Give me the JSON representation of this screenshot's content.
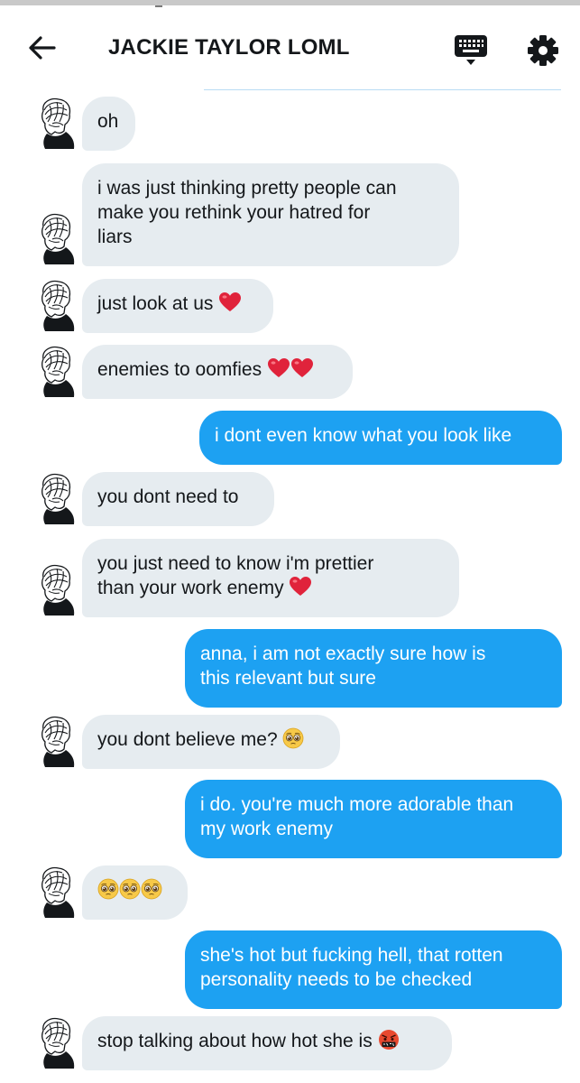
{
  "header": {
    "title": "JACKIE TAYLOR LOML"
  },
  "colors": {
    "incoming_bubble": "#e6ecf0",
    "outgoing_bubble": "#1da1f2",
    "heart": "#e0233b",
    "face": "#f7c948"
  },
  "icons": {
    "back": "arrow-left-icon",
    "keyboard": "keyboard-icon",
    "settings": "gear-icon",
    "avatar": "avatar-portrait"
  },
  "messages": [
    {
      "from": "them",
      "text": "oh"
    },
    {
      "from": "them",
      "text": "i was just thinking pretty people can\nmake you rethink your hatred for\nliars"
    },
    {
      "from": "them",
      "text": "just look at us",
      "emoji": [
        "red-heart"
      ]
    },
    {
      "from": "them",
      "text": "enemies to oomfies",
      "emoji": [
        "red-heart",
        "red-heart"
      ]
    },
    {
      "from": "me",
      "text": "i dont even know what you look like"
    },
    {
      "from": "them",
      "text": "you dont need to"
    },
    {
      "from": "them",
      "text": "you just need to know i'm prettier\nthan your work enemy",
      "emoji": [
        "red-heart"
      ]
    },
    {
      "from": "me",
      "text": "anna, i am not exactly sure how is\nthis relevant but sure"
    },
    {
      "from": "them",
      "text": "you dont believe me?",
      "emoji": [
        "pleading-face"
      ]
    },
    {
      "from": "me",
      "text": "i do. you're much more adorable than\nmy work enemy"
    },
    {
      "from": "them",
      "text": "",
      "emoji": [
        "pleading-face",
        "pleading-face",
        "pleading-face"
      ]
    },
    {
      "from": "me",
      "text": "she's hot but fucking hell, that rotten\npersonality needs to be checked"
    },
    {
      "from": "them",
      "text": "stop talking about how hot she is",
      "emoji": [
        "cursing-face"
      ]
    }
  ]
}
